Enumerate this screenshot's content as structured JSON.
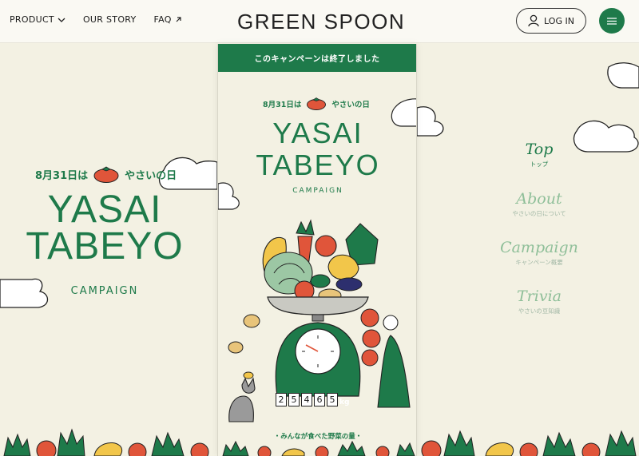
{
  "header": {
    "nav": [
      {
        "label": "PRODUCT",
        "icon": "chevron-down-icon"
      },
      {
        "label": "OUR STORY"
      },
      {
        "label": "FAQ",
        "icon": "external-arrow-icon"
      }
    ],
    "logo": "GREEN SPOON",
    "login_label": "LOG IN",
    "menu_icon": "hamburger-icon"
  },
  "hero_left": {
    "date": "8月31日は",
    "date_suffix": "やさいの日",
    "title_line1": "YASAI",
    "title_line2": "TABEYO",
    "campaign": "CAMPAIGN"
  },
  "phone": {
    "banner": "このキャンペーンは終了しました",
    "date": "8月31日は",
    "date_suffix": "やさいの日",
    "title_line1": "YASAI",
    "title_line2": "TABEYO",
    "campaign": "CAMPAIGN",
    "counter_digits": [
      "2",
      "5",
      "4",
      "6",
      "5"
    ],
    "counter_unit": "kg",
    "caption": "・みんなが食べた野菜の量・"
  },
  "side_nav": [
    {
      "en": "Top",
      "jp": "トップ",
      "active": true
    },
    {
      "en": "About",
      "jp": "やさいの日について",
      "active": false
    },
    {
      "en": "Campaign",
      "jp": "キャンペーン概要",
      "active": false
    },
    {
      "en": "Trivia",
      "jp": "やさいの豆知識",
      "active": false
    }
  ],
  "colors": {
    "brand_green": "#1e7a4a",
    "background": "#f3f1e3",
    "tomato": "#e0553a",
    "yellow": "#f2c64a"
  }
}
